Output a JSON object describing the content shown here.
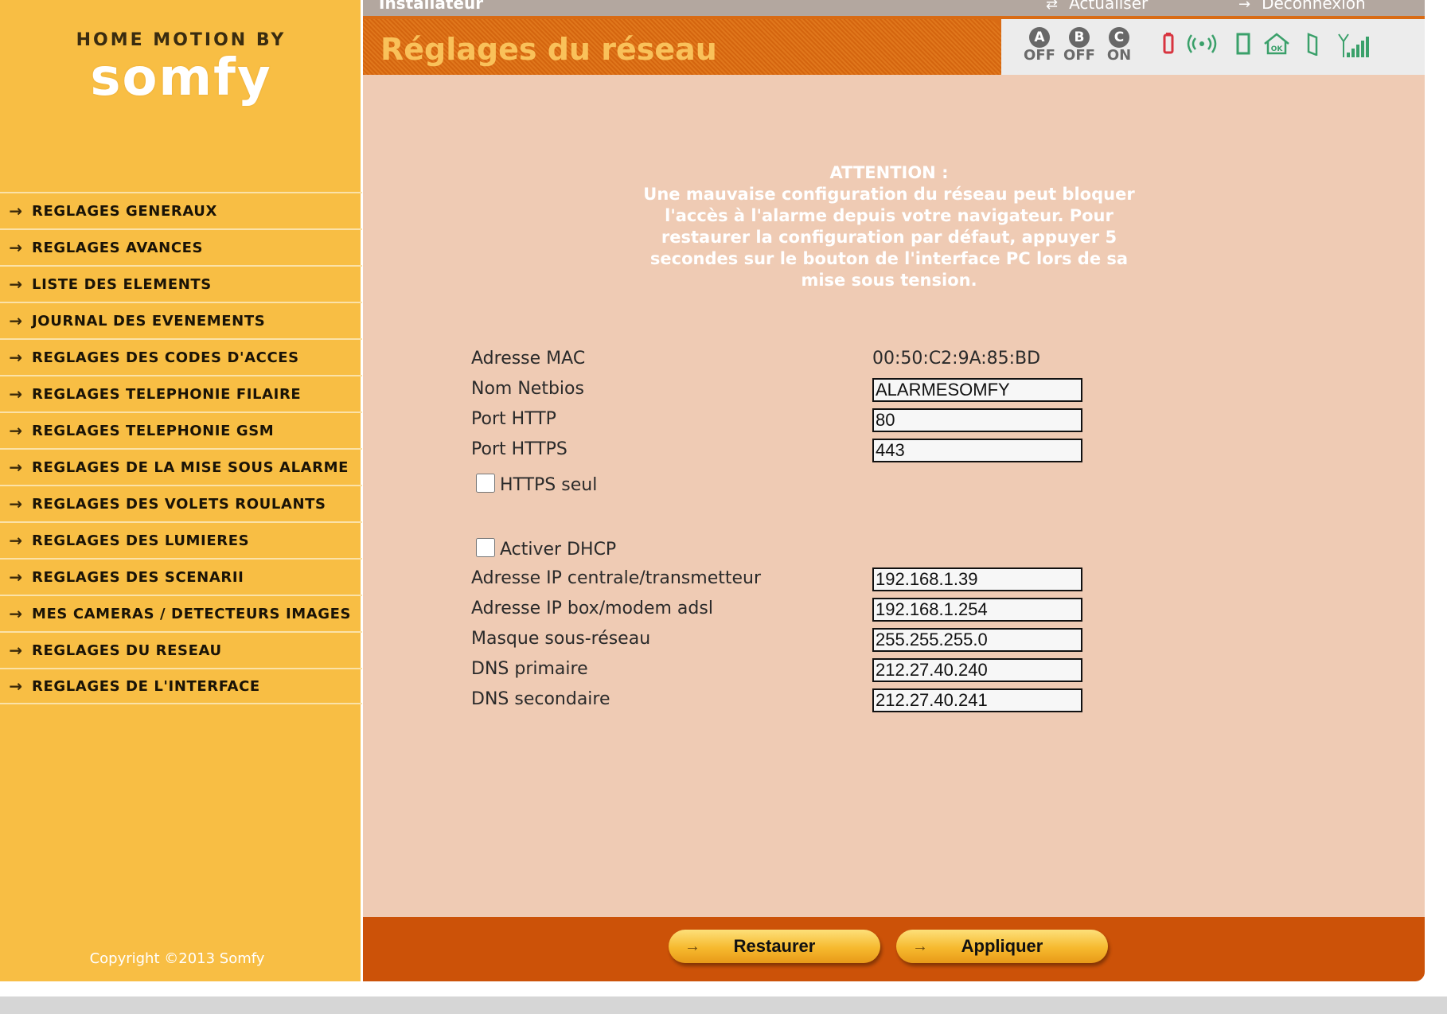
{
  "topbar": {
    "user": "Installateur",
    "refresh": "Actualiser",
    "logout": "Déconnexion"
  },
  "logo": {
    "top": "HOME MOTION BY",
    "brand": "somfy"
  },
  "sidebar": {
    "items": [
      {
        "label": "REGLAGES GENERAUX"
      },
      {
        "label": "REGLAGES AVANCES"
      },
      {
        "label": "LISTE DES ELEMENTS"
      },
      {
        "label": "JOURNAL DES EVENEMENTS"
      },
      {
        "label": "REGLAGES DES CODES D'ACCES"
      },
      {
        "label": "REGLAGES TELEPHONIE FILAIRE"
      },
      {
        "label": "REGLAGES TELEPHONIE GSM"
      },
      {
        "label": "REGLAGES DE LA MISE SOUS ALARME"
      },
      {
        "label": "REGLAGES DES VOLETS ROULANTS"
      },
      {
        "label": "REGLAGES DES LUMIERES"
      },
      {
        "label": "REGLAGES DES SCENARII"
      },
      {
        "label": "MES CAMERAS / DETECTEURS IMAGES"
      },
      {
        "label": "REGLAGES DU RESEAU"
      },
      {
        "label": "REGLAGES DE L'INTERFACE"
      }
    ],
    "copyright": "Copyright ©2013 Somfy"
  },
  "header": {
    "title": "Réglages du réseau",
    "zones": [
      {
        "letter": "A",
        "state": "OFF"
      },
      {
        "letter": "B",
        "state": "OFF"
      },
      {
        "letter": "C",
        "state": "ON"
      }
    ],
    "status_icons": [
      "battery-icon",
      "radio-signal-icon",
      "door-icon",
      "house-ok-icon",
      "door-open-icon",
      "gsm-signal-icon"
    ],
    "colors": {
      "battery": "#d8343f",
      "status": "#3aa06a"
    }
  },
  "warning": {
    "title": "ATTENTION :",
    "text": "Une mauvaise configuration du réseau peut bloquer l'accès à l'alarme depuis votre navigateur. Pour restaurer la configuration par défaut, appuyer 5 secondes sur le bouton de l'interface PC lors de sa mise sous tension."
  },
  "form": {
    "mac_label": "Adresse MAC",
    "mac_value": "00:50:C2:9A:85:BD",
    "netbios_label": "Nom Netbios",
    "netbios_value": "ALARMESOMFY",
    "http_label": "Port HTTP",
    "http_value": "80",
    "https_label": "Port HTTPS",
    "https_value": "443",
    "https_only_label": "HTTPS seul",
    "https_only_checked": false,
    "dhcp_label": "Activer DHCP",
    "dhcp_checked": false,
    "ip_label": "Adresse IP centrale/transmetteur",
    "ip_value": "192.168.1.39",
    "gateway_label": "Adresse IP box/modem adsl",
    "gateway_value": "192.168.1.254",
    "mask_label": "Masque sous-réseau",
    "mask_value": "255.255.255.0",
    "dns1_label": "DNS primaire",
    "dns1_value": "212.27.40.240",
    "dns2_label": "DNS secondaire",
    "dns2_value": "212.27.40.241"
  },
  "footer": {
    "restore_label": "Restaurer",
    "apply_label": "Appliquer"
  }
}
